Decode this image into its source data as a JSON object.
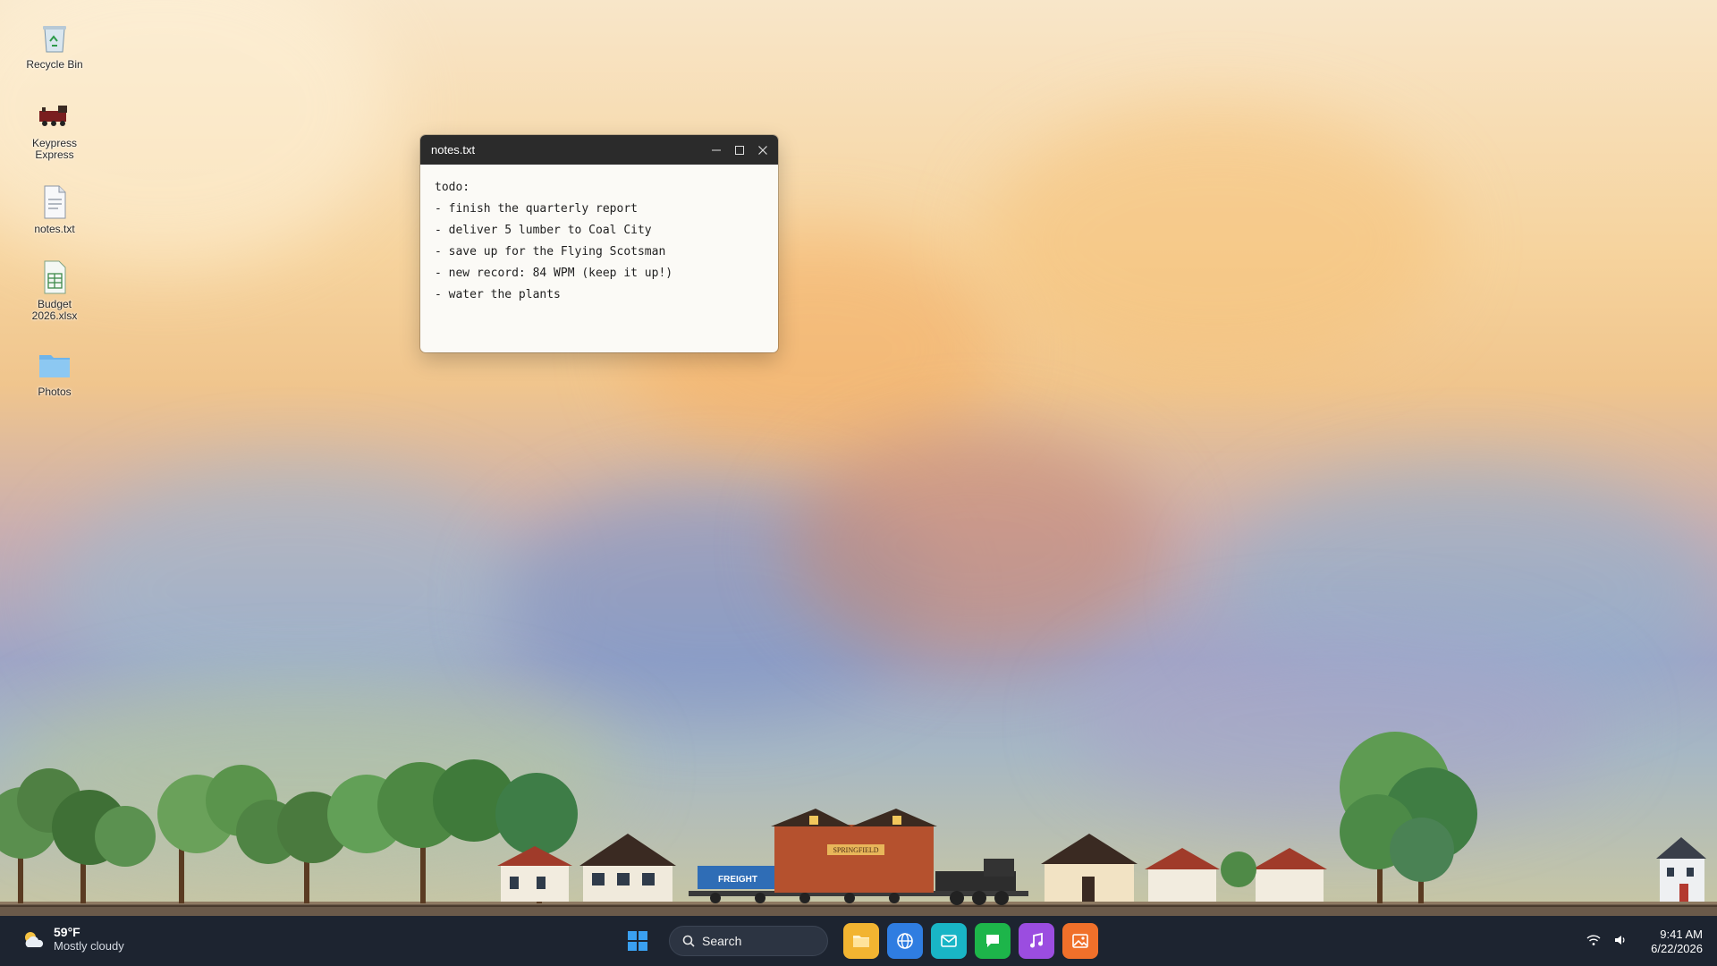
{
  "desktop": {
    "icons": [
      {
        "label": "Recycle Bin",
        "icon": "recycle-bin-icon"
      },
      {
        "label": "Keypress Express",
        "icon": "train-icon"
      },
      {
        "label": "notes.txt",
        "icon": "text-file-icon"
      },
      {
        "label": "Budget 2026.xlsx",
        "icon": "spreadsheet-icon"
      },
      {
        "label": "Photos",
        "icon": "folder-icon"
      }
    ]
  },
  "notepad": {
    "title": "notes.txt",
    "content": "todo:\n- finish the quarterly report\n- deliver 5 lumber to Coal City\n- save up for the Flying Scotsman\n- new record: 84 WPM (keep it up!)\n- water the plants"
  },
  "scene": {
    "station_sign": "SPRINGFIELD",
    "freight_label": "FREIGHT"
  },
  "taskbar": {
    "weather": {
      "temp": "59°F",
      "condition": "Mostly cloudy"
    },
    "search_placeholder": "Search",
    "apps": [
      {
        "name": "File Explorer",
        "icon": "folder-icon",
        "color": "#f2b431"
      },
      {
        "name": "Browser",
        "icon": "globe-icon",
        "color": "#2f7de1"
      },
      {
        "name": "Mail",
        "icon": "mail-icon",
        "color": "#19b5c6"
      },
      {
        "name": "Chat",
        "icon": "chat-icon",
        "color": "#1db54a"
      },
      {
        "name": "Music",
        "icon": "music-icon",
        "color": "#9b4de0"
      },
      {
        "name": "Photos",
        "icon": "image-icon",
        "color": "#f0702a"
      }
    ],
    "clock": {
      "time": "9:41 AM",
      "date": "6/22/2026"
    }
  }
}
